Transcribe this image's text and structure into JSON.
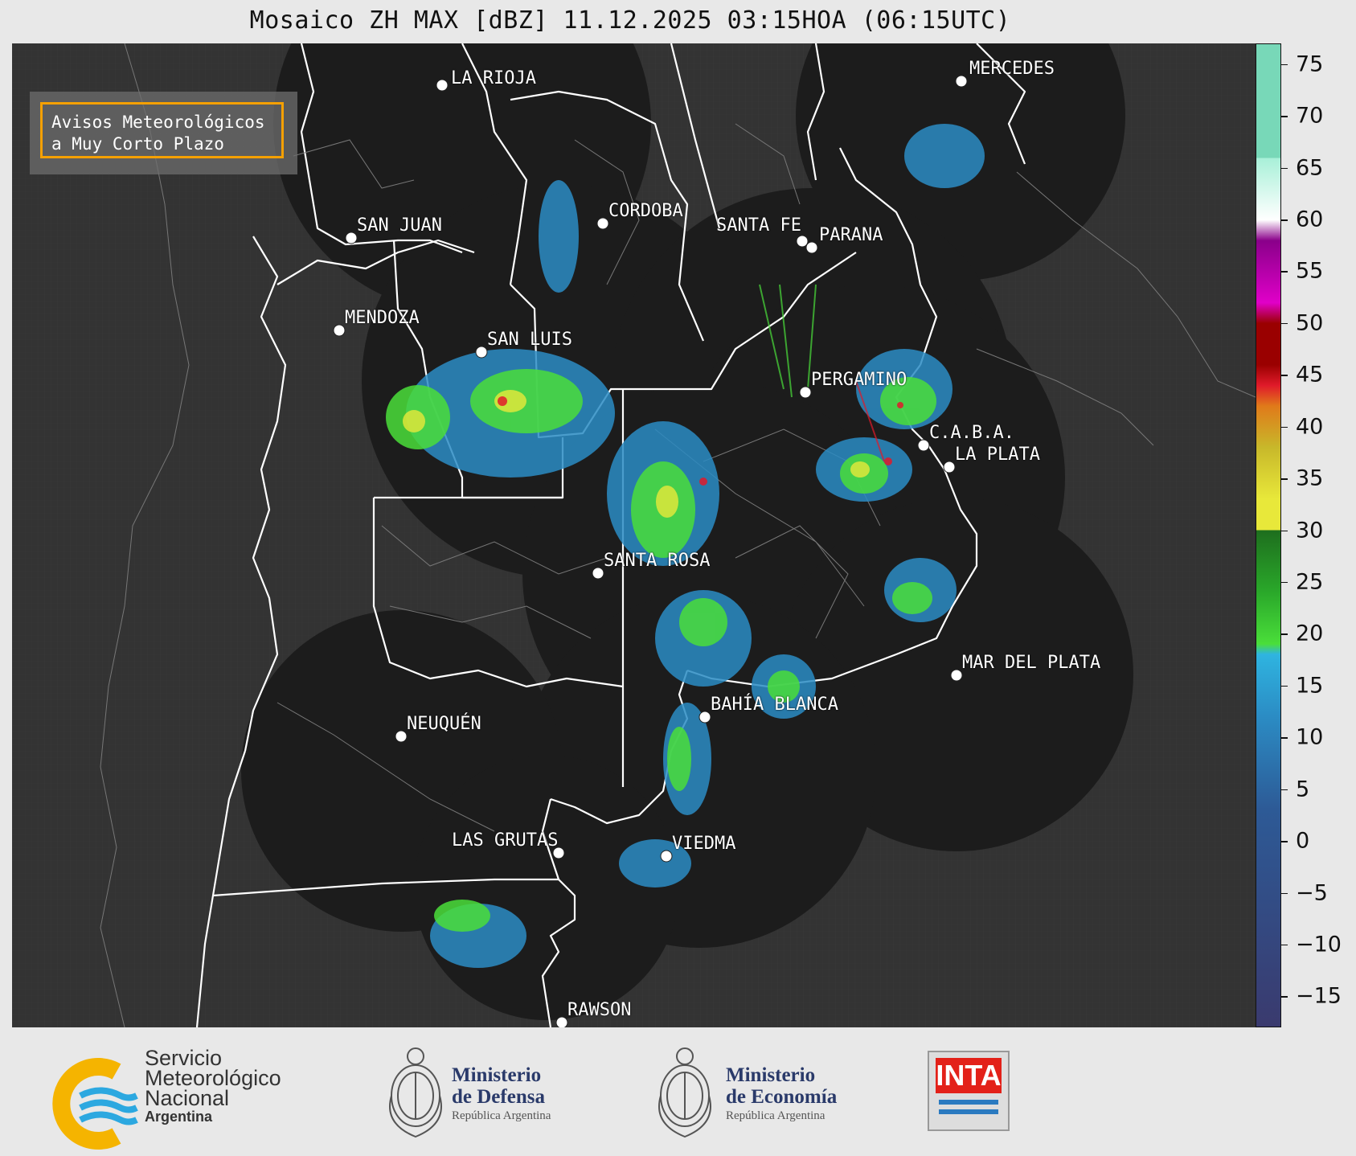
{
  "title": "Mosaico ZH MAX [dBZ] 11.12.2025 03:15HOA (06:15UTC)",
  "notice": {
    "line1": "Avisos Meteorológicos",
    "line2": "a Muy Corto Plazo",
    "border_color": "#f5a000"
  },
  "cities": [
    {
      "name": "LA RIOJA"
    },
    {
      "name": "MERCEDES"
    },
    {
      "name": "CORDOBA"
    },
    {
      "name": "SAN JUAN"
    },
    {
      "name": "SANTA FE"
    },
    {
      "name": "PARANA"
    },
    {
      "name": "MENDOZA"
    },
    {
      "name": "SAN LUIS"
    },
    {
      "name": "PERGAMINO"
    },
    {
      "name": "C.A.B.A."
    },
    {
      "name": "LA PLATA"
    },
    {
      "name": "SANTA ROSA"
    },
    {
      "name": "MAR DEL PLATA"
    },
    {
      "name": "BAHÍA BLANCA"
    },
    {
      "name": "NEUQUÉN"
    },
    {
      "name": "LAS GRUTAS"
    },
    {
      "name": "VIEDMA"
    },
    {
      "name": "RAWSON"
    }
  ],
  "colorbar": {
    "unit": "dBZ",
    "range": [
      -18,
      77
    ],
    "ticks": [
      "75",
      "70",
      "65",
      "60",
      "55",
      "50",
      "45",
      "40",
      "35",
      "30",
      "25",
      "20",
      "15",
      "10",
      "5",
      "0",
      "−5",
      "−10",
      "−15"
    ],
    "colors": {
      "lowest": "#3a3a6e",
      "blue_dark": "#2d5a96",
      "blue": "#2b8cc4",
      "cyan": "#2fb4e0",
      "green_light": "#4ade3a",
      "green": "#2aa82a",
      "green_dark": "#1e6e1e",
      "yellow": "#e8e83a",
      "olive": "#c8b82a",
      "orange": "#e07a1a",
      "red": "#e01a2a",
      "dark_red": "#9a0000",
      "magenta": "#e000c8",
      "purple": "#8a008a",
      "white": "#ffffff",
      "mint": "#a8f0d8",
      "teal": "#78d8b8"
    }
  },
  "logos": {
    "smn": {
      "line1": "Servicio",
      "line2": "Meteorológico",
      "line3": "Nacional",
      "line4": "Argentina"
    },
    "defensa": {
      "line1": "Ministerio",
      "line2": "de Defensa",
      "line3": "República Argentina"
    },
    "economia": {
      "line1": "Ministerio",
      "line2": "de Economía",
      "line3": "República Argentina"
    },
    "inta": {
      "text": "INTA"
    }
  }
}
